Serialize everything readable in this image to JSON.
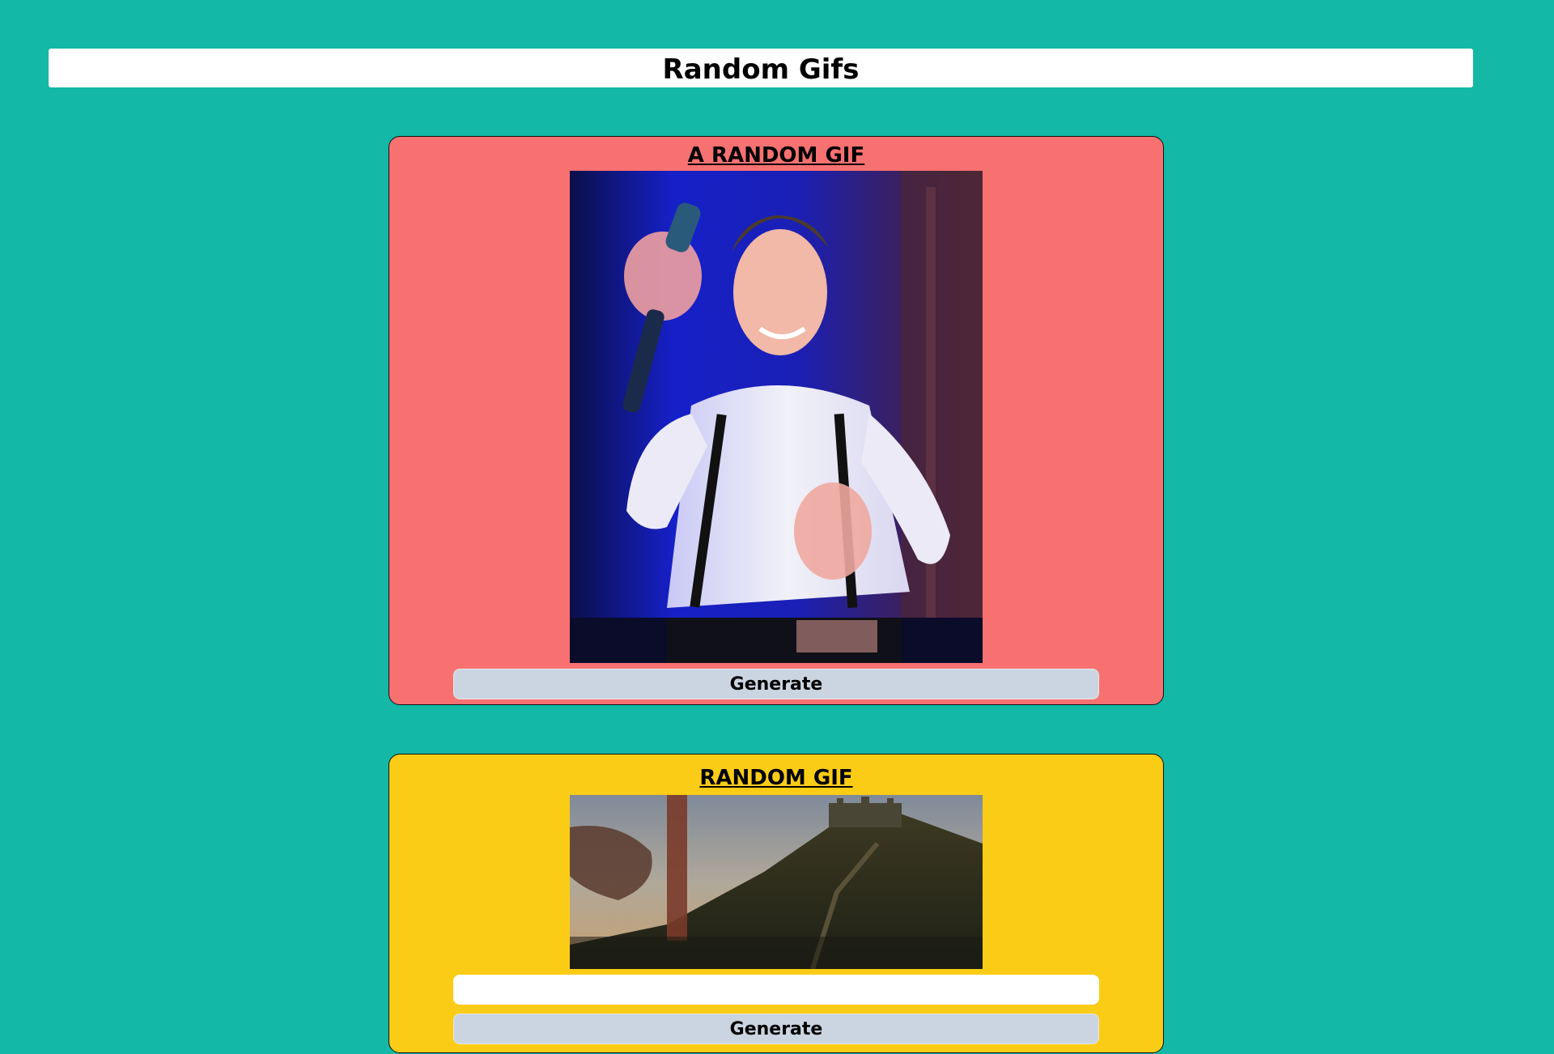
{
  "header": {
    "title": "Random Gifs"
  },
  "random_card": {
    "title": "A RANDOM GIF",
    "generate_label": "Generate",
    "background": "#f87171"
  },
  "tag_card": {
    "title": "RANDOM GIF",
    "input_value": "",
    "generate_label": "Generate",
    "background": "#facc15"
  },
  "colors": {
    "page_background": "#14b8a6",
    "button_background": "#cbd5e1"
  }
}
